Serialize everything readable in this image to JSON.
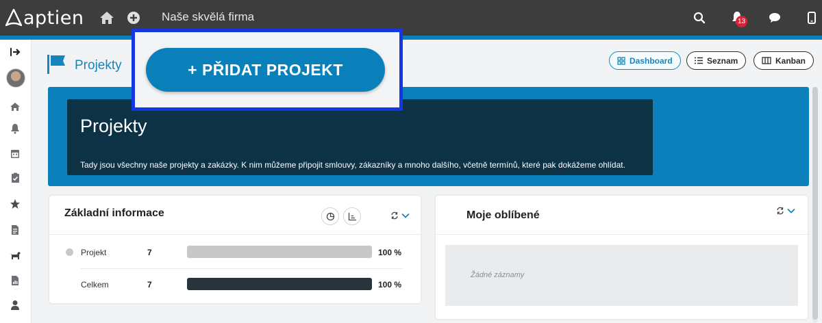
{
  "app": {
    "logo_text": "aptien",
    "company_name": "Naše skvělá firma",
    "notification_count": "13",
    "accent_color": "#0a80ba"
  },
  "topbar": {
    "icons": [
      "home-icon",
      "add-circle-icon",
      "search-icon",
      "bell-icon",
      "chat-icon",
      "mobile-icon"
    ]
  },
  "sidebar": {
    "items": [
      "collapse-icon",
      "avatar",
      "home-icon",
      "bell-icon",
      "calendar-icon",
      "clipboard-icon",
      "star-icon",
      "document-icon",
      "dog-icon",
      "report-icon",
      "user-icon"
    ]
  },
  "header": {
    "title": "Projekty",
    "views": [
      {
        "label": "Dashboard",
        "icon": "grid-icon",
        "active": true
      },
      {
        "label": "Seznam",
        "icon": "list-icon",
        "active": false
      },
      {
        "label": "Kanban",
        "icon": "columns-icon",
        "active": false
      }
    ]
  },
  "hero": {
    "title": "Projekty",
    "description": "Tady jsou všechny naše projekty a zakázky. K nim můžeme připojit smlouvy, zákazníky a mnoho dalšího, včetně termínů, které pak dokážeme ohlídat."
  },
  "basic_info": {
    "title": "Základní informace",
    "rows": [
      {
        "label": "Projekt",
        "count": "7",
        "percent": "100 %",
        "fraction": 1.0,
        "bar_color": "#c8c8c8",
        "dot_color": "#c8c8c8"
      },
      {
        "label": "Celkem",
        "count": "7",
        "percent": "100 %",
        "fraction": 1.0,
        "bar_color": "#27343b"
      }
    ]
  },
  "favorites": {
    "title": "Moje oblíbené",
    "empty_text": "Žádné záznamy"
  },
  "popup": {
    "add_project_label": "+ PŘIDAT PROJEKT"
  }
}
